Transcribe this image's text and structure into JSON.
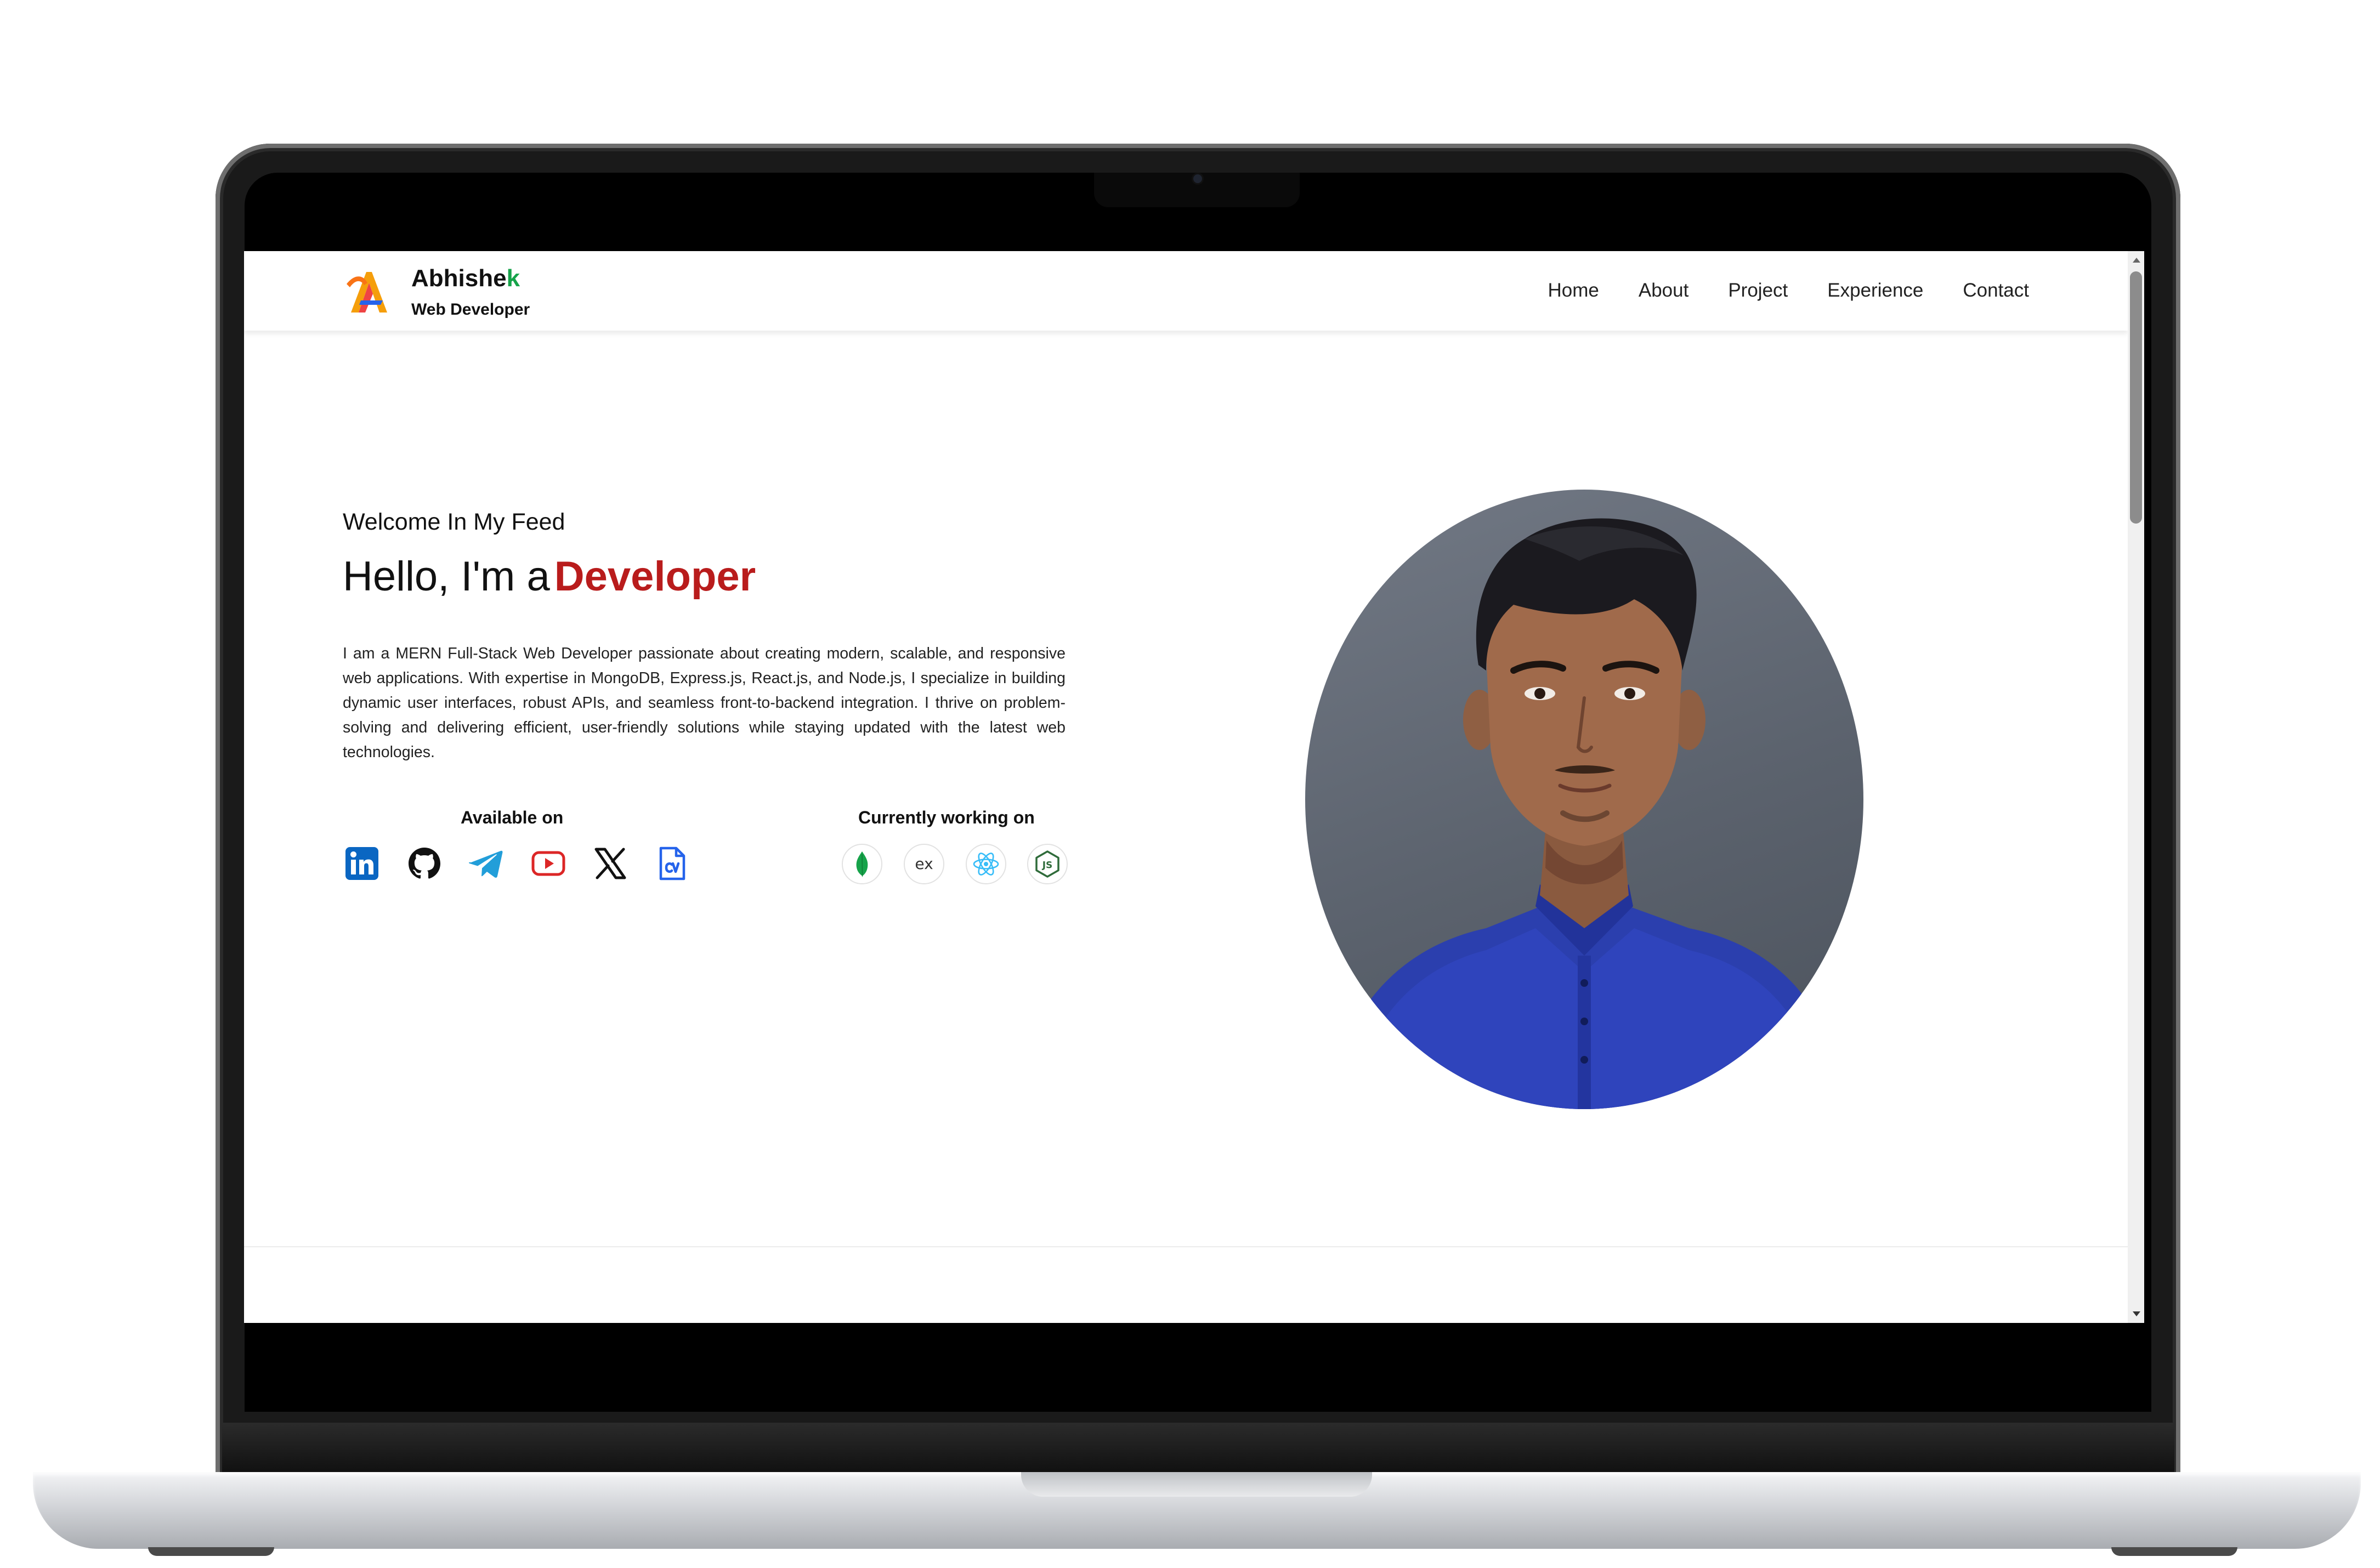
{
  "brand": {
    "name_main": "Abhishe",
    "name_accent": "k",
    "tagline": "Web Developer"
  },
  "nav": {
    "items": [
      "Home",
      "About",
      "Project",
      "Experience",
      "Contact"
    ]
  },
  "hero": {
    "welcome": "Welcome In My Feed",
    "greeting": "Hello, I'm a",
    "role": "Developer",
    "description": "I am a MERN Full-Stack Web Developer passionate about creating modern, scalable, and responsive web applications. With expertise in MongoDB, Express.js, React.js, and Node.js, I specialize in building dynamic user interfaces, robust APIs, and seamless front-to-backend integration. I thrive on problem-solving and delivering efficient, user-friendly solutions while staying updated with the latest web technologies."
  },
  "available": {
    "title": "Available on",
    "icons": [
      "linkedin-icon",
      "github-icon",
      "telegram-icon",
      "youtube-icon",
      "x-icon",
      "cv-icon"
    ]
  },
  "working": {
    "title": "Currently working on",
    "icons": [
      "mongodb-icon",
      "express-icon",
      "react-icon",
      "nodejs-icon"
    ],
    "express_text": "ex",
    "node_text": "JS"
  },
  "colors": {
    "accent_red": "#b91c1c",
    "brand_green": "#16a34a",
    "linkedin": "#0a66c2",
    "telegram": "#229ed9",
    "youtube": "#dc2626",
    "cv": "#2563eb",
    "react": "#38bdf8",
    "mongodb": "#16a34a",
    "node": "#2f6b3a"
  }
}
